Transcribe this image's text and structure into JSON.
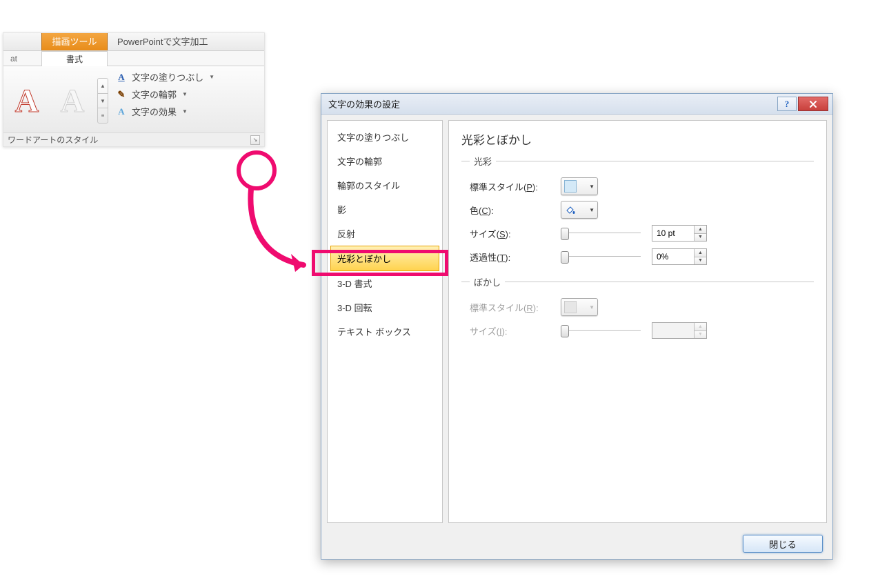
{
  "ribbon": {
    "context_tab": "描画ツール",
    "doc_title": "PowerPointで文字加工",
    "sub_tab_at": "at",
    "sub_tab_format": "書式",
    "wa_letter": "A",
    "btn_fill": "文字の塗りつぶし",
    "btn_outline": "文字の輪郭",
    "btn_effects": "文字の効果",
    "group_label": "ワードアートのスタイル"
  },
  "dialog": {
    "title": "文字の効果の設定",
    "categories": [
      "文字の塗りつぶし",
      "文字の輪郭",
      "輪郭のスタイル",
      "影",
      "反射",
      "光彩とぼかし",
      "3-D 書式",
      "3-D 回転",
      "テキスト ボックス"
    ],
    "pane": {
      "heading": "光彩とぼかし",
      "glow_legend": "光彩",
      "blur_legend": "ぼかし",
      "preset_label_pre": "標準スタイル(",
      "preset_key_p": "P",
      "preset_key_r": "R",
      "label_close": "):",
      "color_label_pre": "色(",
      "color_key": "C",
      "size_label_pre": "サイズ(",
      "size_key_s": "S",
      "size_key_i": "I",
      "trans_label_pre": "透過性(",
      "trans_key": "T",
      "size_value": "10 pt",
      "trans_value": "0%"
    },
    "close_button": "閉じる"
  }
}
